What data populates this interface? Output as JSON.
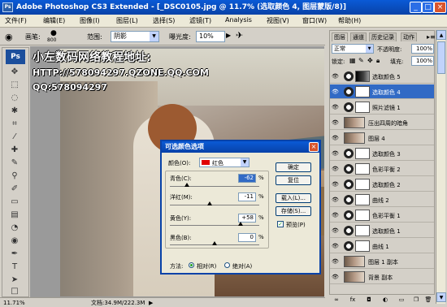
{
  "window": {
    "title": "Adobe Photoshop CS3 Extended - [_DSC0105.jpg @ 11.7% (选取颜色 4, 图层蒙版/8)]",
    "min_label": "_",
    "max_label": "□",
    "close_label": "×"
  },
  "menu": [
    "文件(F)",
    "编辑(E)",
    "图像(I)",
    "图层(L)",
    "选择(S)",
    "滤镜(T)",
    "Analysis",
    "视图(V)",
    "窗口(W)",
    "帮助(H)"
  ],
  "options": {
    "brush_label": "画笔:",
    "brush_size": "800",
    "range_label": "范围:",
    "range_value": "阴影",
    "exposure_label": "曝光度:",
    "exposure_value": "10%"
  },
  "toolbox": {
    "logo": "Ps"
  },
  "watermark": {
    "line1": "小左数码网络教程地址:",
    "line2": "HTTP://578094297.QZONE.QQ.COM",
    "line3": "QQ:578094297"
  },
  "status": {
    "zoom": "11.71%",
    "doc": "文档:34.9M/222.3M"
  },
  "dialog": {
    "title": "可选颜色选项",
    "colors_label": "颜色(O):",
    "colors_value": "红色",
    "close_label": "×",
    "sliders": [
      {
        "label": "青色(C):",
        "value": "-62",
        "unit": "%",
        "fraction": 0.19
      },
      {
        "label": "洋红(M):",
        "value": "-11",
        "unit": "%",
        "fraction": 0.445
      },
      {
        "label": "黄色(Y):",
        "value": "+58",
        "unit": "%",
        "fraction": 0.79
      },
      {
        "label": "黑色(B):",
        "value": "0",
        "unit": "%",
        "fraction": 0.5
      }
    ],
    "buttons": {
      "ok": "确定",
      "reset": "复位",
      "load": "载入(L)...",
      "save": "存储(S)..."
    },
    "preview_label": "预览(P)",
    "method_label": "方法:",
    "relative_label": "相对(R)",
    "absolute_label": "绝对(A)"
  },
  "panels": {
    "tabs": [
      "图层",
      "通道",
      "历史记录",
      "动作"
    ],
    "blend_mode": "正常",
    "opacity_label": "不透明度:",
    "opacity_value": "100%",
    "lock_label": "锁定:",
    "fill_label": "填充:",
    "fill_value": "100%",
    "layers": [
      {
        "name": "选取颜色 5",
        "kind": "adj-dark"
      },
      {
        "name": "选取颜色 4",
        "kind": "adj",
        "selected": true
      },
      {
        "name": "照片滤镜 1",
        "kind": "adj"
      },
      {
        "name": "压出四周的暗角",
        "kind": "photo"
      },
      {
        "name": "图层 4",
        "kind": "photo"
      },
      {
        "name": "选取颜色 3",
        "kind": "adj"
      },
      {
        "name": "色彩平衡 2",
        "kind": "adj"
      },
      {
        "name": "选取颜色 2",
        "kind": "adj"
      },
      {
        "name": "曲线 2",
        "kind": "adj"
      },
      {
        "name": "色彩平衡 1",
        "kind": "adj"
      },
      {
        "name": "选取颜色 1",
        "kind": "adj"
      },
      {
        "name": "曲线 1",
        "kind": "adj"
      },
      {
        "name": "图层 1 副本",
        "kind": "photo"
      },
      {
        "name": "背景 副本",
        "kind": "photo"
      }
    ]
  }
}
